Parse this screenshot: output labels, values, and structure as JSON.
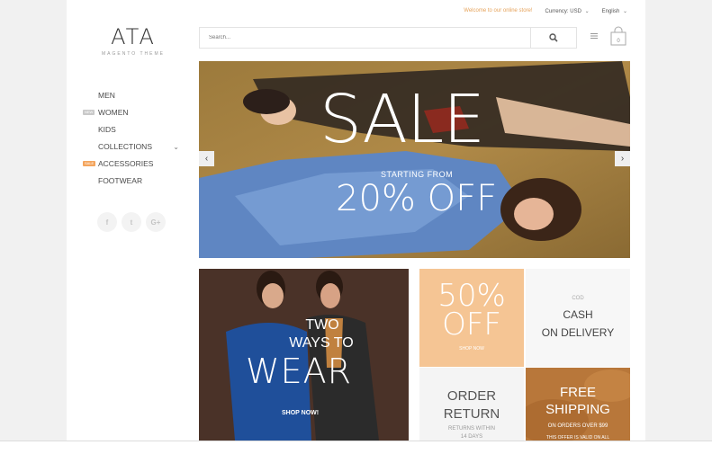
{
  "topbar": {
    "welcome": "Welcome to our online store!",
    "currency_label": "Currency:",
    "currency_value": "USD",
    "language": "English"
  },
  "logo": {
    "mark": "ATA",
    "subtitle": "MAGENTO THEME"
  },
  "search": {
    "placeholder": "Search..."
  },
  "cart": {
    "count": "0"
  },
  "nav": {
    "items": [
      {
        "label": "MEN"
      },
      {
        "label": "WOMEN",
        "badge": "NEW"
      },
      {
        "label": "KIDS"
      },
      {
        "label": "COLLECTIONS",
        "chevron": "chevron-down-icon"
      },
      {
        "label": "ACCESSORIES",
        "badge": "SALE"
      },
      {
        "label": "FOOTWEAR"
      }
    ]
  },
  "social": {
    "facebook": "f",
    "twitter": "t",
    "google": "G+"
  },
  "hero": {
    "title": "SALE",
    "subtitle": "STARTING FROM",
    "discount": "20% OFF",
    "prev_arrow": "‹",
    "next_arrow": "›"
  },
  "promo_wear": {
    "line1": "TWO",
    "line2": "WAYS TO",
    "line3": "WEAR",
    "cta": "SHOP NOW!"
  },
  "tiles": {
    "discount": {
      "line1": "50%",
      "line2": "OFF",
      "cta": "SHOP NOW"
    },
    "cod": {
      "small": "COD",
      "line1": "CASH",
      "line2": "ON DELIVERY"
    },
    "return": {
      "line1": "ORDER",
      "line2": "RETURN",
      "sub1": "RETURNS WITHIN",
      "sub2": "14 DAYS"
    },
    "shipping": {
      "line1": "FREE",
      "line2": "SHIPPING",
      "sub": "ON ORDERS OVER $99",
      "sub2": "THIS OFFER IS VALID ON ALL"
    }
  },
  "colors": {
    "accent_orange": "#f5c594",
    "badge_sale": "#f4a55d",
    "text_dark": "#4a4a4a"
  }
}
